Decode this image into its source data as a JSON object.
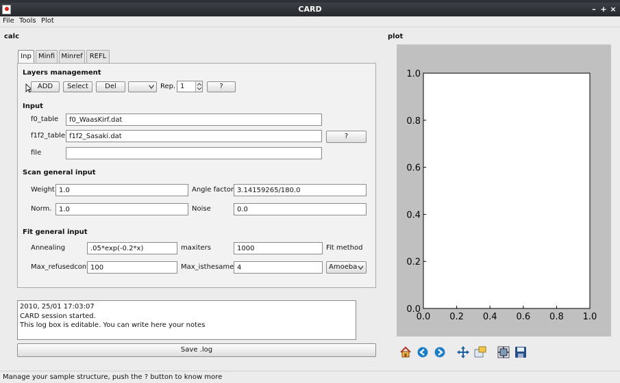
{
  "window": {
    "title": "CARD"
  },
  "menubar": {
    "items": [
      {
        "label": "File"
      },
      {
        "label": "Tools"
      },
      {
        "label": "Plot"
      }
    ]
  },
  "left_panel": {
    "title": "calc"
  },
  "tabs": [
    {
      "label": "Inp"
    },
    {
      "label": "Minfi"
    },
    {
      "label": "Minref"
    },
    {
      "label": "REFL"
    }
  ],
  "layers": {
    "title": "Layers management",
    "add_label": "ADD",
    "select_label": "Select",
    "del_label": "Del",
    "combo_value": "",
    "rep_label": "Rep.",
    "rep_value": "1",
    "help_label": "?"
  },
  "input": {
    "title": "Input",
    "f0_label": "f0_table",
    "f0_value": "f0_WaasKirf.dat",
    "f1f2_label": "f1f2_table",
    "f1f2_value": "f1f2_Sasaki.dat",
    "help_label": "?",
    "file_label": "file",
    "file_value": ""
  },
  "scan": {
    "title": "Scan general input",
    "weight_label": "Weight",
    "weight_value": "1.0",
    "angle_label": "Angle factor",
    "angle_value": "3.14159265/180.0",
    "norm_label": "Norm.",
    "norm_value": "1.0",
    "noise_label": "Noise",
    "noise_value": "0.0"
  },
  "fit": {
    "title": "Fit general input",
    "annealing_label": "Annealing",
    "annealing_value": ".05*exp(-0.2*x)",
    "maxiters_label": "maxiters",
    "maxiters_value": "1000",
    "method_label": "Fit method",
    "refused_label": "Max_refusedcont",
    "refused_value": "100",
    "isthesame_label": "Max_isthesame",
    "isthesame_value": "4",
    "method_value": "Amoeba"
  },
  "log": {
    "lines": [
      "2010, 25/01 17:03:07",
      "CARD session started.",
      "This log box is editable. You can write here your notes"
    ],
    "save_label": "Save .log"
  },
  "plot": {
    "title": "plot",
    "xticks": [
      "0.0",
      "0.2",
      "0.4",
      "0.6",
      "0.8",
      "1.0"
    ],
    "yticks": [
      "0.0",
      "0.2",
      "0.4",
      "0.6",
      "0.8",
      "1.0"
    ]
  },
  "chart_data": {
    "type": "line",
    "series": [],
    "xlim": [
      0,
      1
    ],
    "ylim": [
      0,
      1
    ],
    "xticks": [
      0.0,
      0.2,
      0.4,
      0.6,
      0.8,
      1.0
    ],
    "yticks": [
      0.0,
      0.2,
      0.4,
      0.6,
      0.8,
      1.0
    ]
  },
  "toolbar": {
    "icons": [
      "home-icon",
      "back-arrow-icon",
      "forward-arrow-icon",
      "pan-move-icon",
      "zoom-rect-icon",
      "subplot-config-icon",
      "save-icon"
    ]
  },
  "status": {
    "text": "Manage your sample structure, push the ? button to know more"
  },
  "colors": {
    "titlebar": "#2d3035",
    "accent_blue": "#1f7fc4",
    "tab_active": "#f6f6f6"
  }
}
